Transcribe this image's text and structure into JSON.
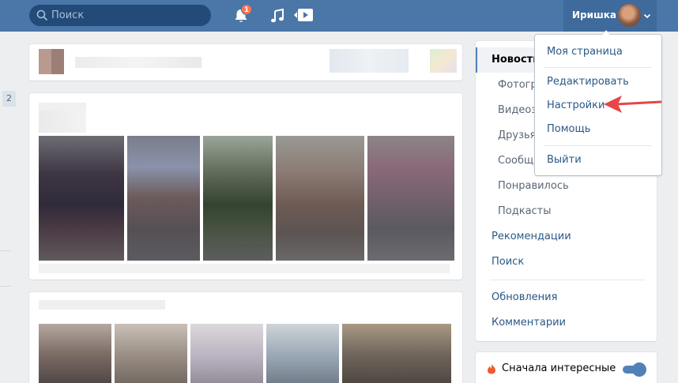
{
  "header": {
    "search_placeholder": "Поиск",
    "notification_count": "1",
    "profile_name": "Иришка"
  },
  "left": {
    "counter": "2"
  },
  "right_menu": {
    "items": [
      {
        "label": "Новости",
        "active": true
      },
      {
        "label": "Фотографии"
      },
      {
        "label": "Видеозаписи"
      },
      {
        "label": "Друзья"
      },
      {
        "label": "Сообщества"
      },
      {
        "label": "Понравилось"
      },
      {
        "label": "Подкасты"
      },
      {
        "label": "Рекомендации"
      },
      {
        "label": "Поиск"
      },
      {
        "label": "Обновления"
      },
      {
        "label": "Комментарии"
      }
    ]
  },
  "filter": {
    "label": "Сначала интересные",
    "enabled": true
  },
  "dropdown": {
    "items": [
      "Моя страница",
      "Редактировать",
      "Настройки",
      "Помощь",
      "Выйти"
    ],
    "highlighted": "Настройки"
  },
  "colors": {
    "header_bg": "#4a76a8",
    "link": "#2a5885",
    "arrow": "#e64646",
    "badge": "#ff734c"
  }
}
